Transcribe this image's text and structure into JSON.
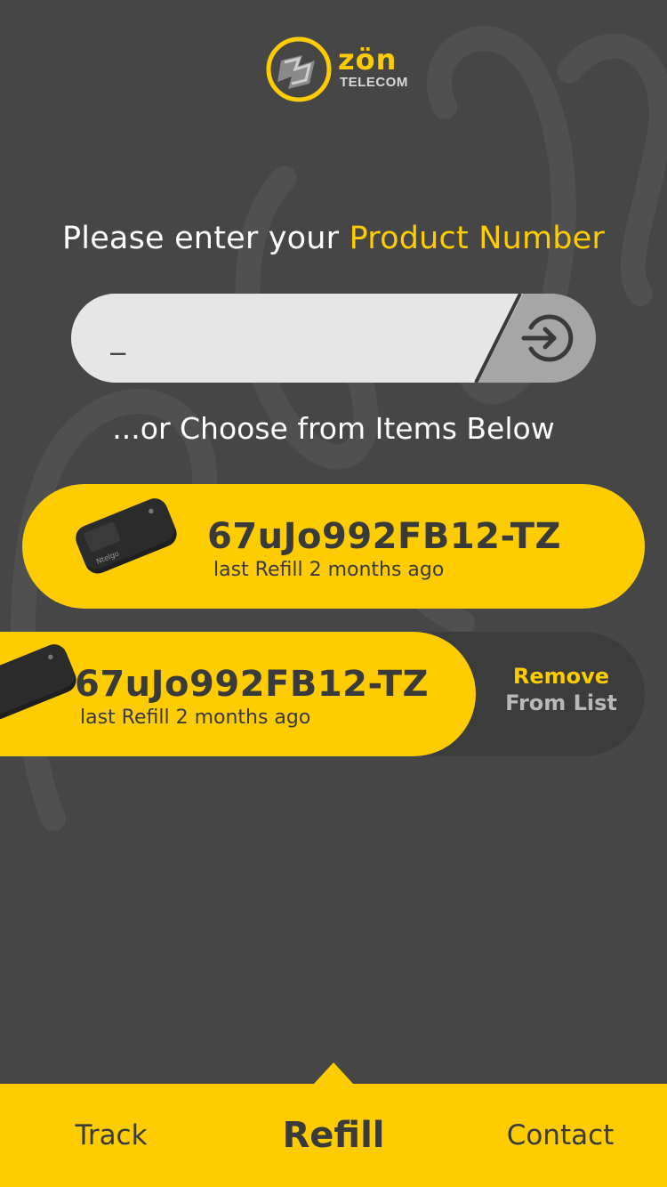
{
  "brand": {
    "name": "zön",
    "subtitle": "TELECOM",
    "accent_color": "#ffcc00",
    "background_color": "#464646"
  },
  "prompt": {
    "prefix": "Please enter your ",
    "highlight": "Product Number"
  },
  "product_input": {
    "value": "_",
    "submit_icon": "arrow-right-circle-icon"
  },
  "or_text": "...or Choose from Items Below",
  "items": [
    {
      "id": "67uJo992FB12-TZ",
      "subtitle": "last Refill 2 months ago",
      "image": "mobile-hotspot-device"
    },
    {
      "id": "67uJo992FB12-TZ",
      "subtitle": "last Refill 2 months ago",
      "image": "mobile-hotspot-device"
    }
  ],
  "swipe_action": {
    "line1": "Remove",
    "line2": "From List"
  },
  "bottom_nav": {
    "tabs": [
      {
        "label": "Track",
        "active": false
      },
      {
        "label": "Refill",
        "active": true
      },
      {
        "label": "Contact",
        "active": false
      }
    ]
  }
}
